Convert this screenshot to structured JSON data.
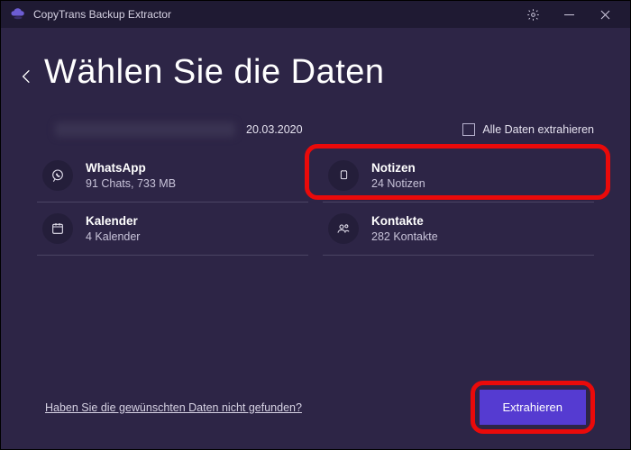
{
  "titlebar": {
    "app_name": "CopyTrans Backup Extractor"
  },
  "heading": "Wählen Sie die Daten",
  "backup_date": "20.03.2020",
  "select_all_label": "Alle Daten extrahieren",
  "items": {
    "whatsapp": {
      "label": "WhatsApp",
      "detail": "91 Chats, 733 MB"
    },
    "notes": {
      "label": "Notizen",
      "detail": "24 Notizen"
    },
    "calendar": {
      "label": "Kalender",
      "detail": "4 Kalender"
    },
    "contacts": {
      "label": "Kontakte",
      "detail": "282 Kontakte"
    }
  },
  "help_link": "Haben Sie die gewünschten Daten nicht gefunden?",
  "extract_button": "Extrahieren",
  "colors": {
    "accent": "#553bd1",
    "highlight": "#ea0a0a",
    "bg": "#2d2546"
  }
}
